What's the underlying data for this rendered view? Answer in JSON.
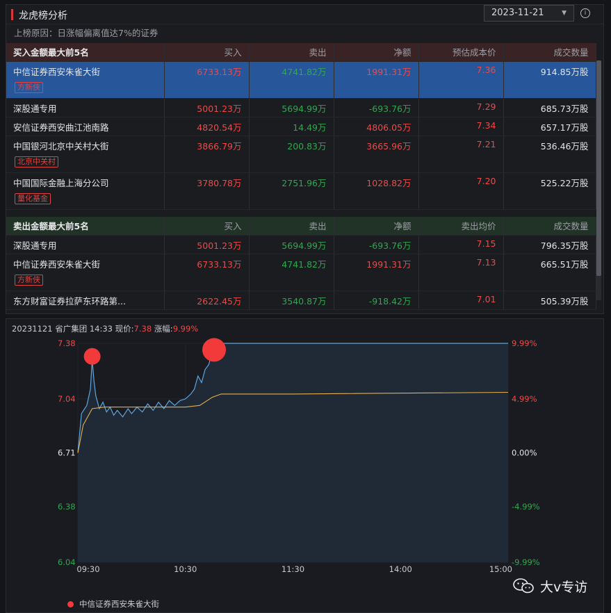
{
  "header": {
    "title": "龙虎榜分析",
    "date": "2023-11-21",
    "reason": "上榜原因：日涨幅偏离值达7%的证券"
  },
  "buy_table": {
    "columns": [
      "买入金额最大前5名",
      "买入",
      "卖出",
      "净额",
      "预估成本价",
      "成交数量"
    ],
    "rows": [
      {
        "name": "中信证券西安朱雀大街",
        "buy": "6733.13万",
        "sell": "4741.82万",
        "net": "1991.31万",
        "price": "7.36",
        "volume": "914.85万股",
        "tag": "方新侠"
      },
      {
        "name": "深股通专用",
        "buy": "5001.23万",
        "sell": "5694.99万",
        "net": "-693.76万",
        "price": "7.29",
        "volume": "685.73万股",
        "tag": ""
      },
      {
        "name": "安信证券西安曲江池南路",
        "buy": "4820.54万",
        "sell": "14.49万",
        "net": "4806.05万",
        "price": "7.34",
        "volume": "657.17万股",
        "tag": ""
      },
      {
        "name": "中国银河北京中关村大街",
        "buy": "3866.79万",
        "sell": "200.83万",
        "net": "3665.96万",
        "price": "7.21",
        "volume": "536.46万股",
        "tag": "北京中关村"
      },
      {
        "name": "中国国际金融上海分公司",
        "buy": "3780.78万",
        "sell": "2751.96万",
        "net": "1028.82万",
        "price": "7.20",
        "volume": "525.22万股",
        "tag": "量化基金"
      }
    ]
  },
  "sell_table": {
    "columns": [
      "卖出金额最大前5名",
      "买入",
      "卖出",
      "净额",
      "卖出均价",
      "成交数量"
    ],
    "rows": [
      {
        "name": "深股通专用",
        "buy": "5001.23万",
        "sell": "5694.99万",
        "net": "-693.76万",
        "price": "7.15",
        "volume": "796.35万股",
        "tag": ""
      },
      {
        "name": "中信证券西安朱雀大街",
        "buy": "6733.13万",
        "sell": "4741.82万",
        "net": "1991.31万",
        "price": "7.13",
        "volume": "665.51万股",
        "tag": "方新侠"
      },
      {
        "name": "东方财富证券拉萨东环路第...",
        "buy": "2622.45万",
        "sell": "3540.87万",
        "net": "-918.42万",
        "price": "7.01",
        "volume": "505.39万股",
        "tag": ""
      }
    ]
  },
  "chart": {
    "head_date": "20231121",
    "head_name": "省广集团",
    "head_time": "14:33",
    "price_label": "现价:",
    "price": "7.38",
    "change_label": "涨幅:",
    "change": "9.99%",
    "legend": "中信证券西安朱雀大街",
    "watermark": "大v专访"
  },
  "chart_data": {
    "type": "line",
    "x_ticks": [
      "09:30",
      "10:30",
      "11:30",
      "14:00",
      "15:00"
    ],
    "y_left_ticks": [
      "7.38",
      "7.04",
      "6.71",
      "6.38",
      "6.04"
    ],
    "y_right_ticks": [
      "9.99%",
      "4.99%",
      "0.00%",
      "-4.99%",
      "-9.99%"
    ],
    "ylim": [
      6.04,
      7.38
    ],
    "prev_close": 6.71,
    "series": [
      {
        "name": "price",
        "color": "#5ea6df",
        "points": [
          [
            "09:30",
            6.71
          ],
          [
            "09:32",
            6.95
          ],
          [
            "09:35",
            7.0
          ],
          [
            "09:37",
            7.1
          ],
          [
            "09:38",
            7.28
          ],
          [
            "09:39",
            7.15
          ],
          [
            "09:40",
            7.06
          ],
          [
            "09:42",
            6.98
          ],
          [
            "09:44",
            7.02
          ],
          [
            "09:46",
            6.96
          ],
          [
            "09:48",
            6.99
          ],
          [
            "09:50",
            6.94
          ],
          [
            "09:52",
            6.97
          ],
          [
            "09:55",
            6.93
          ],
          [
            "09:58",
            6.98
          ],
          [
            "10:00",
            6.95
          ],
          [
            "10:03",
            6.99
          ],
          [
            "10:06",
            6.96
          ],
          [
            "10:09",
            7.01
          ],
          [
            "10:12",
            6.97
          ],
          [
            "10:15",
            7.02
          ],
          [
            "10:18",
            6.98
          ],
          [
            "10:21",
            7.03
          ],
          [
            "10:24",
            7.0
          ],
          [
            "10:27",
            7.03
          ],
          [
            "10:30",
            7.04
          ],
          [
            "10:33",
            7.07
          ],
          [
            "10:35",
            7.1
          ],
          [
            "10:37",
            7.18
          ],
          [
            "10:39",
            7.14
          ],
          [
            "10:41",
            7.22
          ],
          [
            "10:43",
            7.25
          ],
          [
            "10:45",
            7.33
          ],
          [
            "10:46",
            7.38
          ],
          [
            "15:00",
            7.38
          ]
        ]
      },
      {
        "name": "avg",
        "color": "#e7b04c",
        "points": [
          [
            "09:30",
            6.71
          ],
          [
            "09:33",
            6.88
          ],
          [
            "09:38",
            6.98
          ],
          [
            "09:45",
            6.99
          ],
          [
            "10:00",
            6.99
          ],
          [
            "10:30",
            6.99
          ],
          [
            "10:38",
            7.0
          ],
          [
            "10:45",
            7.05
          ],
          [
            "10:50",
            7.07
          ],
          [
            "11:30",
            7.07
          ],
          [
            "15:00",
            7.08
          ]
        ]
      }
    ],
    "markers": [
      {
        "time": "09:38",
        "value": 7.3,
        "size": "small"
      },
      {
        "time": "10:46",
        "value": 7.34,
        "size": "large"
      }
    ]
  }
}
